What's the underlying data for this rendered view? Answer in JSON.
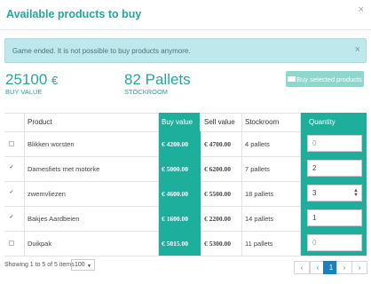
{
  "modal": {
    "title": "Available products to buy",
    "close_glyph": "×"
  },
  "alert": {
    "text": "Game ended. It is not possible to buy products anymore.",
    "close_glyph": "×"
  },
  "stats": {
    "buy_value": "25100",
    "buy_value_currency": "€",
    "buy_value_label": "BUY VALUE",
    "stockroom": "82 Pallets",
    "stockroom_label": "STOCKROOM"
  },
  "buy_button": {
    "label": "Buy selected products",
    "icon": "cart-icon"
  },
  "table": {
    "headers": {
      "product": "Product",
      "buy_value": "Buy value",
      "sell_value": "Sell value",
      "stockroom": "Stockroom",
      "quantity": "Quantity"
    },
    "rows": [
      {
        "checked": false,
        "product": "Blikken worsten",
        "buy": "€ 4200.00",
        "sell": "€ 4700.00",
        "stock": "4 pallets",
        "qty": "0"
      },
      {
        "checked": true,
        "product": "Damesfiets met motorke",
        "buy": "€ 5000.00",
        "sell": "€ 6200.00",
        "stock": "7 pallets",
        "qty": "2"
      },
      {
        "checked": true,
        "product": "zwemvliezen",
        "buy": "€ 4600.00",
        "sell": "€ 5500.00",
        "stock": "18 pallets",
        "qty": "3"
      },
      {
        "checked": true,
        "product": "Bakjes Aardbeien",
        "buy": "€ 1600.00",
        "sell": "€ 2200.00",
        "stock": "14 pallets",
        "qty": "1"
      },
      {
        "checked": false,
        "product": "Duikpak",
        "buy": "€ 5015.00",
        "sell": "€ 5300.00",
        "stock": "11 pallets",
        "qty": "0"
      }
    ]
  },
  "footer": {
    "summary": "Showing 1 to 5 of 5 items",
    "page_size": "100",
    "pager": {
      "first": "‹",
      "prev": "‹",
      "current": "1",
      "next": "›",
      "last": "›"
    }
  },
  "colors": {
    "accent": "#26a69a",
    "header_teal": "#1eae9c",
    "pager_active": "#1f7fb8",
    "alert_bg": "#bfe8ec"
  }
}
